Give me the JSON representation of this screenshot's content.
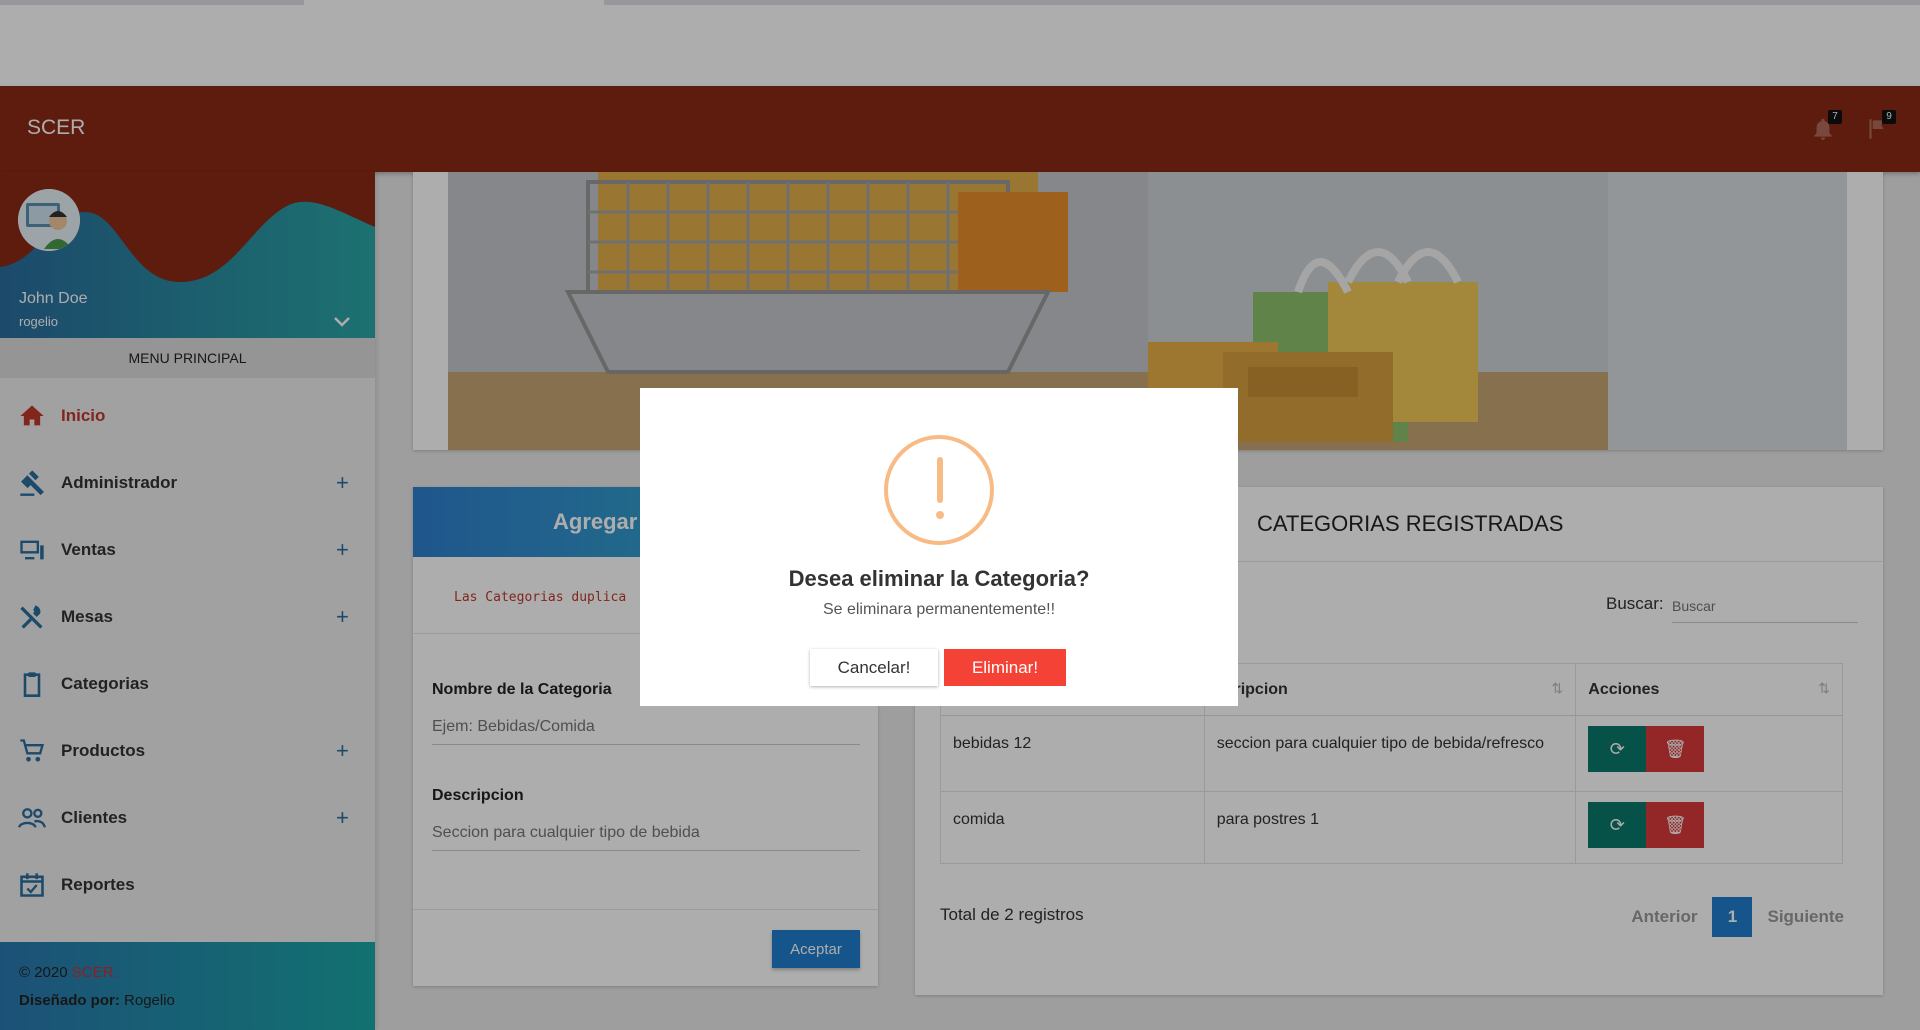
{
  "header": {
    "brand": "SCER",
    "notifications_count": "7",
    "flags_count": "9"
  },
  "sidebar": {
    "user_name": "John Doe",
    "user_login": "rogelio",
    "menu_title": "MENU PRINCIPAL",
    "items": [
      {
        "label": "Inicio",
        "icon": "home-icon",
        "expandable": false
      },
      {
        "label": "Administrador",
        "icon": "gavel-icon",
        "expandable": true
      },
      {
        "label": "Ventas",
        "icon": "monitor-icon",
        "expandable": true
      },
      {
        "label": "Mesas",
        "icon": "utensils-icon",
        "expandable": true
      },
      {
        "label": "Categorias",
        "icon": "clipboard-icon",
        "expandable": false
      },
      {
        "label": "Productos",
        "icon": "cart-icon",
        "expandable": true
      },
      {
        "label": "Clientes",
        "icon": "users-icon",
        "expandable": true
      },
      {
        "label": "Reportes",
        "icon": "calendar-icon",
        "expandable": false
      }
    ],
    "footer_copyright": "© 2020",
    "footer_brand": "SCER.",
    "footer_designed_label": "Diseñado por:",
    "footer_designer": "Rogelio"
  },
  "add_form": {
    "title": "Agregar",
    "note": "Las Categorias duplica",
    "name_label": "Nombre de la Categoria",
    "name_placeholder": "Ejem: Bebidas/Comida",
    "desc_label": "Descripcion",
    "desc_placeholder": "Seccion para cualquier tipo de bebida",
    "submit_label": "Aceptar"
  },
  "list": {
    "title": "CATEGORIAS REGISTRADAS",
    "search_label": "Buscar:",
    "search_placeholder": "Buscar",
    "columns": [
      "",
      "scripcion",
      "Acciones"
    ],
    "rows": [
      {
        "name": "bebidas 12",
        "description": "seccion para cualquier tipo de bebida/refresco"
      },
      {
        "name": "comida",
        "description": "para postres 1"
      }
    ],
    "total": "Total de 2 registros",
    "prev_label": "Anterior",
    "page": "1",
    "next_label": "Siguiente"
  },
  "modal": {
    "title": "Desea eliminar la Categoria?",
    "text": "Se eliminara permanentemente!!",
    "cancel_label": "Cancelar!",
    "confirm_label": "Eliminar!",
    "warning_color": "#f8bb86",
    "confirm_color": "#f44336"
  },
  "colors": {
    "header": "#8a2a14",
    "primary": "#1f7ecf",
    "refresh_button": "#0b7a6a",
    "delete_button": "#d93a3a"
  }
}
